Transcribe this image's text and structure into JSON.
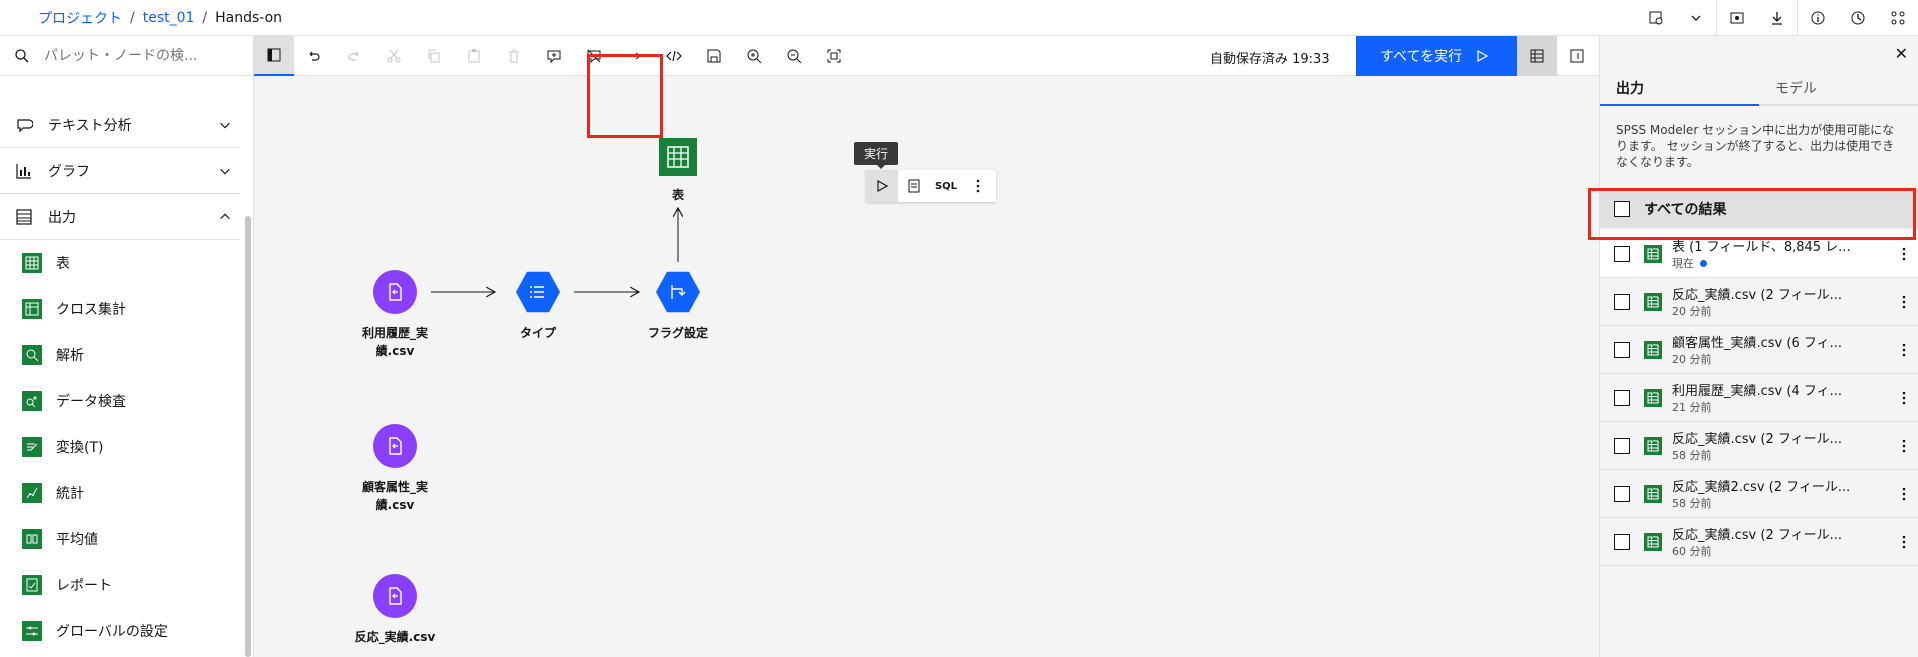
{
  "breadcrumb": {
    "project": "プロジェクト",
    "folder": "test_01",
    "current": "Hands-on",
    "separator": "/"
  },
  "sidebar": {
    "search_placeholder": "パレット・ノードの検...",
    "categories": [
      {
        "label": "テキスト分析",
        "expanded": false
      },
      {
        "label": "グラフ",
        "expanded": false
      },
      {
        "label": "出力",
        "expanded": true
      }
    ],
    "output_items": [
      "表",
      "クロス集計",
      "解析",
      "データ検査",
      "変換(T)",
      "統計",
      "平均値",
      "レポート",
      "グローバルの設定"
    ]
  },
  "toolbar": {
    "autosave": "自動保存済み 19:33",
    "run_all": "すべてを実行"
  },
  "canvas": {
    "tooltip": "実行",
    "mini_sql": "SQL",
    "nodes": {
      "source1": "利用履歴_実\n績.csv",
      "type": "タイプ",
      "flag": "フラグ設定",
      "table": "表",
      "source2": "顧客属性_実\n績.csv",
      "source3": "反応_実績.csv"
    }
  },
  "right_panel": {
    "tabs": [
      "出力",
      "モデル"
    ],
    "description": "SPSS Modeler セッション中に出力が使用可能になります。 セッションが終了すると、出力は使用できなくなります。",
    "all_results": "すべての結果",
    "results": [
      {
        "title": "表 (1 フィールド、8,845 レ...",
        "time": "現在"
      },
      {
        "title": "反応_実績.csv (2 フィール...",
        "time": "20 分前"
      },
      {
        "title": "顧客属性_実績.csv (6 フィ...",
        "time": "20 分前"
      },
      {
        "title": "利用履歴_実績.csv (4 フィ...",
        "time": "21 分前"
      },
      {
        "title": "反応_実績.csv (2 フィール...",
        "time": "58 分前"
      },
      {
        "title": "反応_実績2.csv (2 フィール...",
        "time": "58 分前"
      },
      {
        "title": "反応_実績.csv (2 フィール...",
        "time": "60 分前"
      }
    ]
  }
}
